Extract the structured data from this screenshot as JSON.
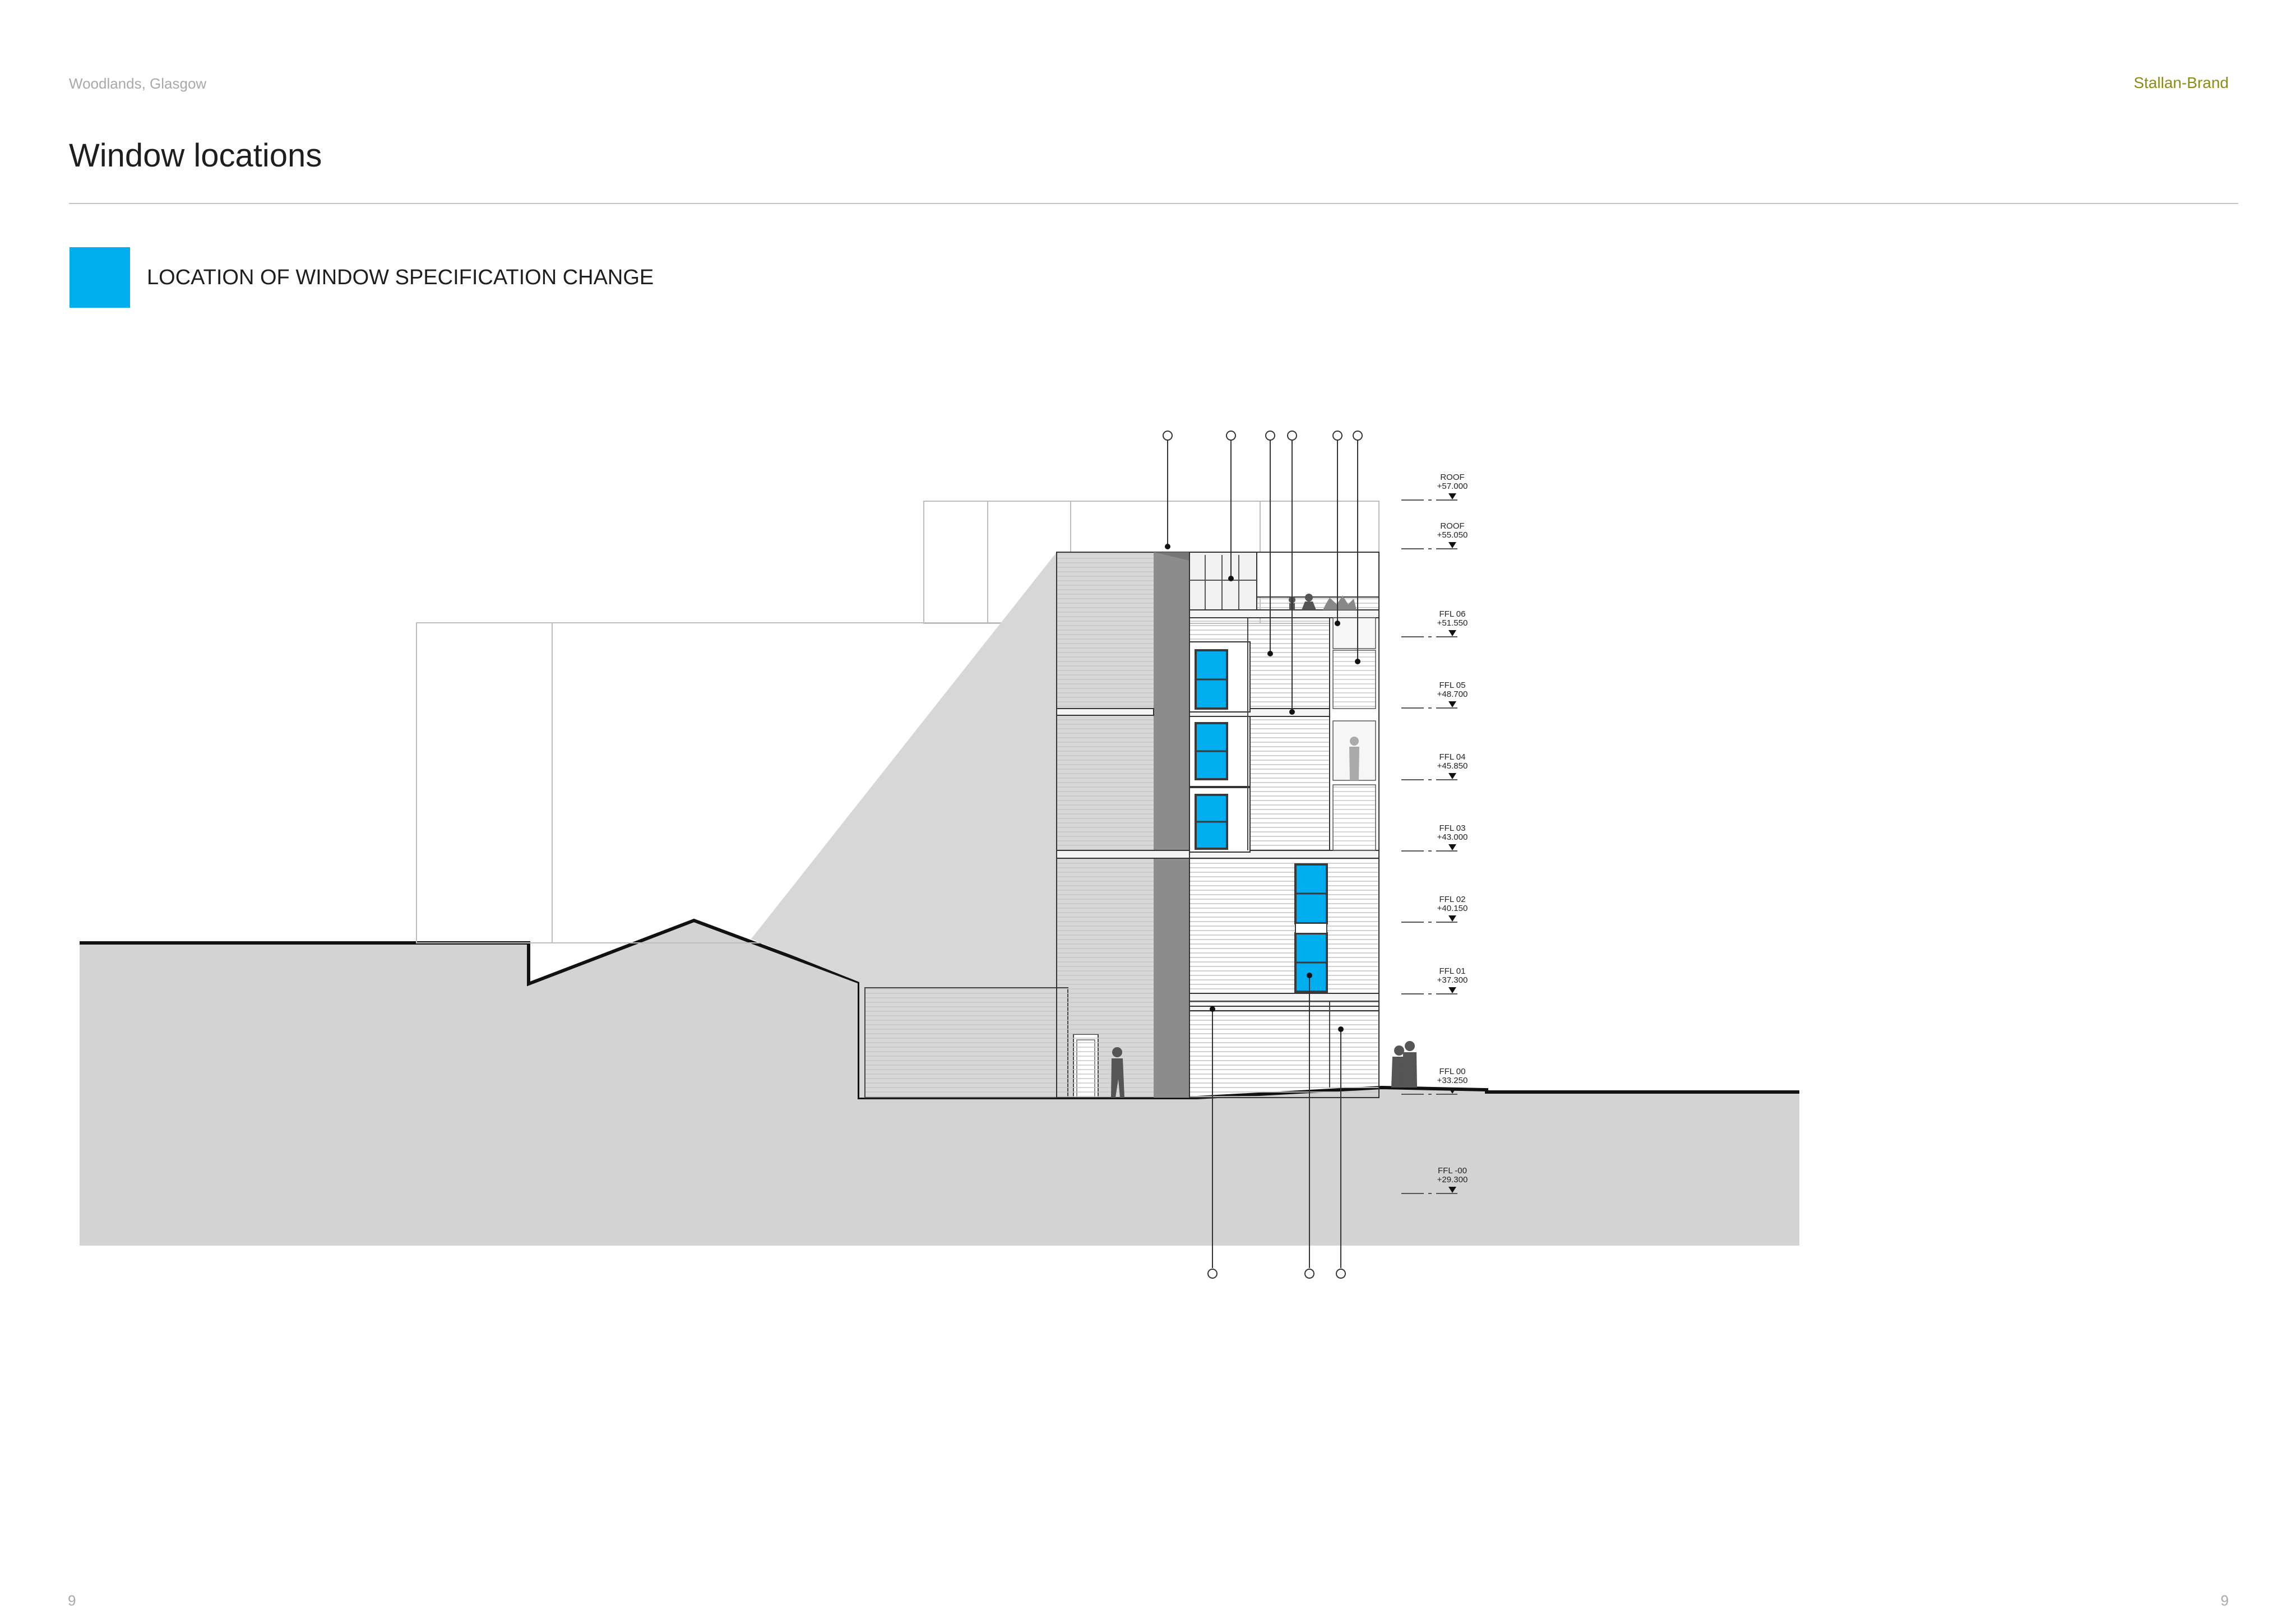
{
  "header": {
    "location": "Woodlands, Glasgow",
    "brand": "Stallan-Brand"
  },
  "title": "Window locations",
  "legend": {
    "label": "LOCATION OF WINDOW SPECIFICATION CHANGE",
    "color": "#00adef"
  },
  "levels": [
    {
      "name": "ROOF",
      "value": "+57.000"
    },
    {
      "name": "ROOF",
      "value": "+55.050"
    },
    {
      "name": "FFL 06",
      "value": "+51.550"
    },
    {
      "name": "FFL 05",
      "value": "+48.700"
    },
    {
      "name": "FFL 04",
      "value": "+45.850"
    },
    {
      "name": "FFL 03",
      "value": "+43.000"
    },
    {
      "name": "FFL 02",
      "value": "+40.150"
    },
    {
      "name": "FFL 01",
      "value": "+37.300"
    },
    {
      "name": "FFL 00",
      "value": "+33.250"
    },
    {
      "name": "FFL -00",
      "value": "+29.300"
    }
  ],
  "footer": {
    "page_left": "9",
    "page_right": "9"
  }
}
